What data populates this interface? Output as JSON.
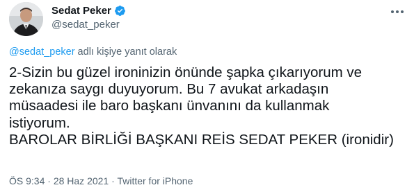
{
  "author": {
    "display_name": "Sedat Peker",
    "handle": "@sedat_peker",
    "verified": true,
    "avatar_icon": "profile-photo",
    "verified_icon": "verified-badge-icon",
    "more_icon": "more-options-icon"
  },
  "reply": {
    "mention": "@sedat_peker",
    "suffix": " adlı kişiye yanıt olarak"
  },
  "tweet": {
    "text": "2-Sizin bu güzel ironinizin önünde şapka çıkarıyorum ve\nzekanıza saygı duyuyorum.  Bu 7 avukat arkadaşın\nmüsaadesi ile baro başkanı ünvanını da kullanmak\nistiyorum.\nBAROLAR BİRLİĞİ BAŞKANI REİS SEDAT PEKER (ironidir)"
  },
  "meta": {
    "time": "ÖS 9:34",
    "separator1": " · ",
    "date": "28 Haz 2021",
    "separator2": " · ",
    "source": "Twitter for iPhone"
  },
  "colors": {
    "text": "#0f1419",
    "secondary": "#536471",
    "link": "#1d9bf0",
    "verified": "#1d9bf0"
  }
}
